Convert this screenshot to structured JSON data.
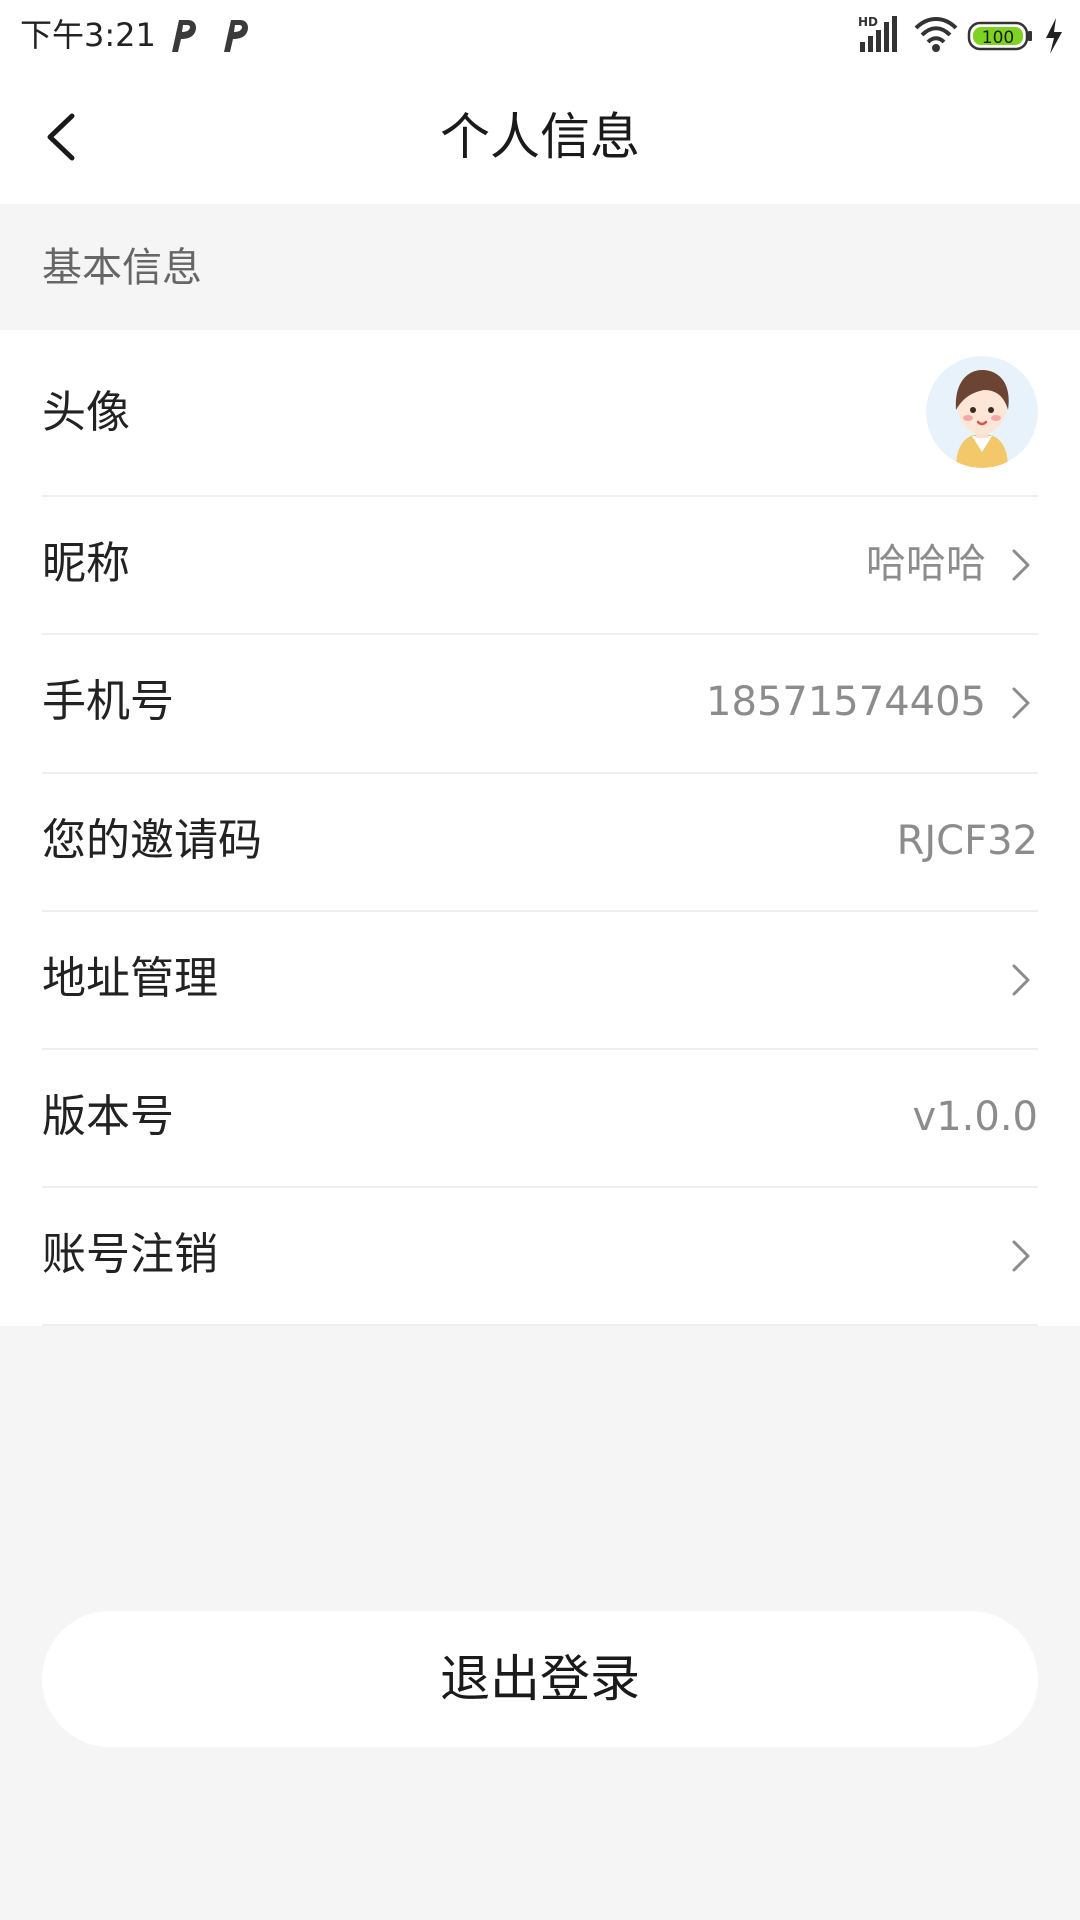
{
  "status_bar": {
    "time": "下午3:21",
    "notification_icons": [
      "p-app-icon",
      "p-app-icon"
    ],
    "right_icons": [
      "hd-signal-icon",
      "wifi-icon",
      "battery-icon",
      "charging-icon"
    ],
    "battery": "100",
    "battery_color": "#7ed321"
  },
  "header": {
    "back_icon": "chevron-left-icon",
    "title": "个人信息"
  },
  "section": {
    "title": "基本信息"
  },
  "rows": {
    "avatar": {
      "label": "头像"
    },
    "nickname": {
      "label": "昵称",
      "value": "哈哈哈"
    },
    "phone": {
      "label": "手机号",
      "value": "18571574405"
    },
    "invite_code": {
      "label": "您的邀请码",
      "value": "RJCF32"
    },
    "address": {
      "label": "地址管理"
    },
    "version": {
      "label": "版本号",
      "value": "v1.0.0"
    },
    "deactivate": {
      "label": "账号注销"
    }
  },
  "logout": {
    "label": "退出登录"
  }
}
